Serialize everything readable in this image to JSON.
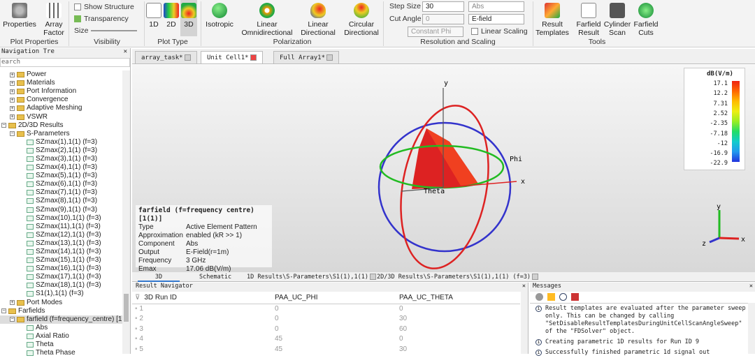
{
  "ribbon": {
    "properties": "Properties",
    "array_factor": "Array Factor",
    "show_structure": "Show Structure",
    "transparency": "Transparency",
    "size": "Size",
    "plot_1d": "1D",
    "plot_2d": "2D",
    "plot_3d": "3D",
    "isotropic": "Isotropic",
    "linear_omni": "Linear Omnidirectional",
    "linear_dir": "Linear Directional",
    "circular_dir": "Circular Directional",
    "step_size_label": "Step Size",
    "step_size": "30",
    "cut_angle_label": "Cut Angle",
    "cut_angle": "0",
    "abs": "Abs",
    "efield": "E-field",
    "constant_phi": "Constant Phi",
    "linear_scaling": "Linear Scaling",
    "result_templates": "Result Templates",
    "farfield_result": "Farfield Result",
    "cylinder_scan": "Cylinder Scan",
    "farfield_cuts": "Farfield Cuts",
    "groups": {
      "plot_properties": "Plot Properties",
      "visibility": "Visibility",
      "plot_type": "Plot Type",
      "polarization": "Polarization",
      "resolution": "Resolution and Scaling",
      "tools": "Tools"
    }
  },
  "nav": {
    "title": "Navigation Tre",
    "search": "earch",
    "items": [
      "Power",
      "Materials",
      "Port Information",
      "Convergence",
      "Adaptive Meshing",
      "VSWR",
      "2D/3D Results",
      "S-Parameters",
      "SZmax(1),1(1) (f=3)",
      "SZmax(2),1(1) (f=3)",
      "SZmax(3),1(1) (f=3)",
      "SZmax(4),1(1) (f=3)",
      "SZmax(5),1(1) (f=3)",
      "SZmax(6),1(1) (f=3)",
      "SZmax(7),1(1) (f=3)",
      "SZmax(8),1(1) (f=3)",
      "SZmax(9),1(1) (f=3)",
      "SZmax(10),1(1) (f=3)",
      "SZmax(11),1(1) (f=3)",
      "SZmax(12),1(1) (f=3)",
      "SZmax(13),1(1) (f=3)",
      "SZmax(14),1(1) (f=3)",
      "SZmax(15),1(1) (f=3)",
      "SZmax(16),1(1) (f=3)",
      "SZmax(17),1(1) (f=3)",
      "SZmax(18),1(1) (f=3)",
      "S1(1),1(1) (f=3)",
      "Port Modes",
      "Farfields",
      "farfield (f=frequency_centre) [1",
      "Abs",
      "Axial Ratio",
      "Theta",
      "Theta Phase"
    ]
  },
  "tabs": [
    "array_task*",
    "Unit Cell1*",
    "Full Array1*"
  ],
  "view": {
    "info_title": "farfield (f=frequency centre) [1(1)]",
    "rows": [
      [
        "Type",
        "Active Element Pattern"
      ],
      [
        "Approximation",
        "enabled (kR >> 1)"
      ],
      [
        "Component",
        "Abs"
      ],
      [
        "Output",
        "E-Field(r=1m)"
      ],
      [
        "Frequency",
        "3 GHz"
      ],
      [
        "Emax",
        "17.06 dB(V/m)"
      ]
    ],
    "axis_x": "x",
    "axis_y": "y",
    "axis_z": "z",
    "phi": "Phi",
    "theta": "Theta"
  },
  "legend": {
    "title": "dB(V/m)",
    "ticks": [
      "17.1",
      "12.2",
      "7.31",
      "2.52",
      "-2.35",
      "-7.18",
      "-12",
      "-16.9",
      "-22.9"
    ]
  },
  "bottom_tabs": [
    "3D",
    "Schematic",
    "1D Results\\S-Parameters\\S1(1),1(1)",
    "2D/3D Results\\S-Parameters\\S1(1),1(1)  (f=3)"
  ],
  "results": {
    "title": "Result Navigator",
    "cols": [
      "3D Run ID",
      "PAA_UC_PHI",
      "PAA_UC_THETA"
    ],
    "rows": [
      [
        "1",
        "0",
        "0"
      ],
      [
        "2",
        "0",
        "30"
      ],
      [
        "3",
        "0",
        "60"
      ],
      [
        "4",
        "45",
        "0"
      ],
      [
        "5",
        "45",
        "30"
      ]
    ]
  },
  "messages": {
    "title": "Messages",
    "items": [
      "Result templates are evaluated after the parameter sweep only. This can be changed by calling \"SetDisableResultTemplatesDuringUnitCellScanAngleSweep\" of the \"FDSolver\" object.",
      "Creating parametric 1D results for Run ID 9",
      "Successfully finished parametric 1d signal out"
    ]
  }
}
